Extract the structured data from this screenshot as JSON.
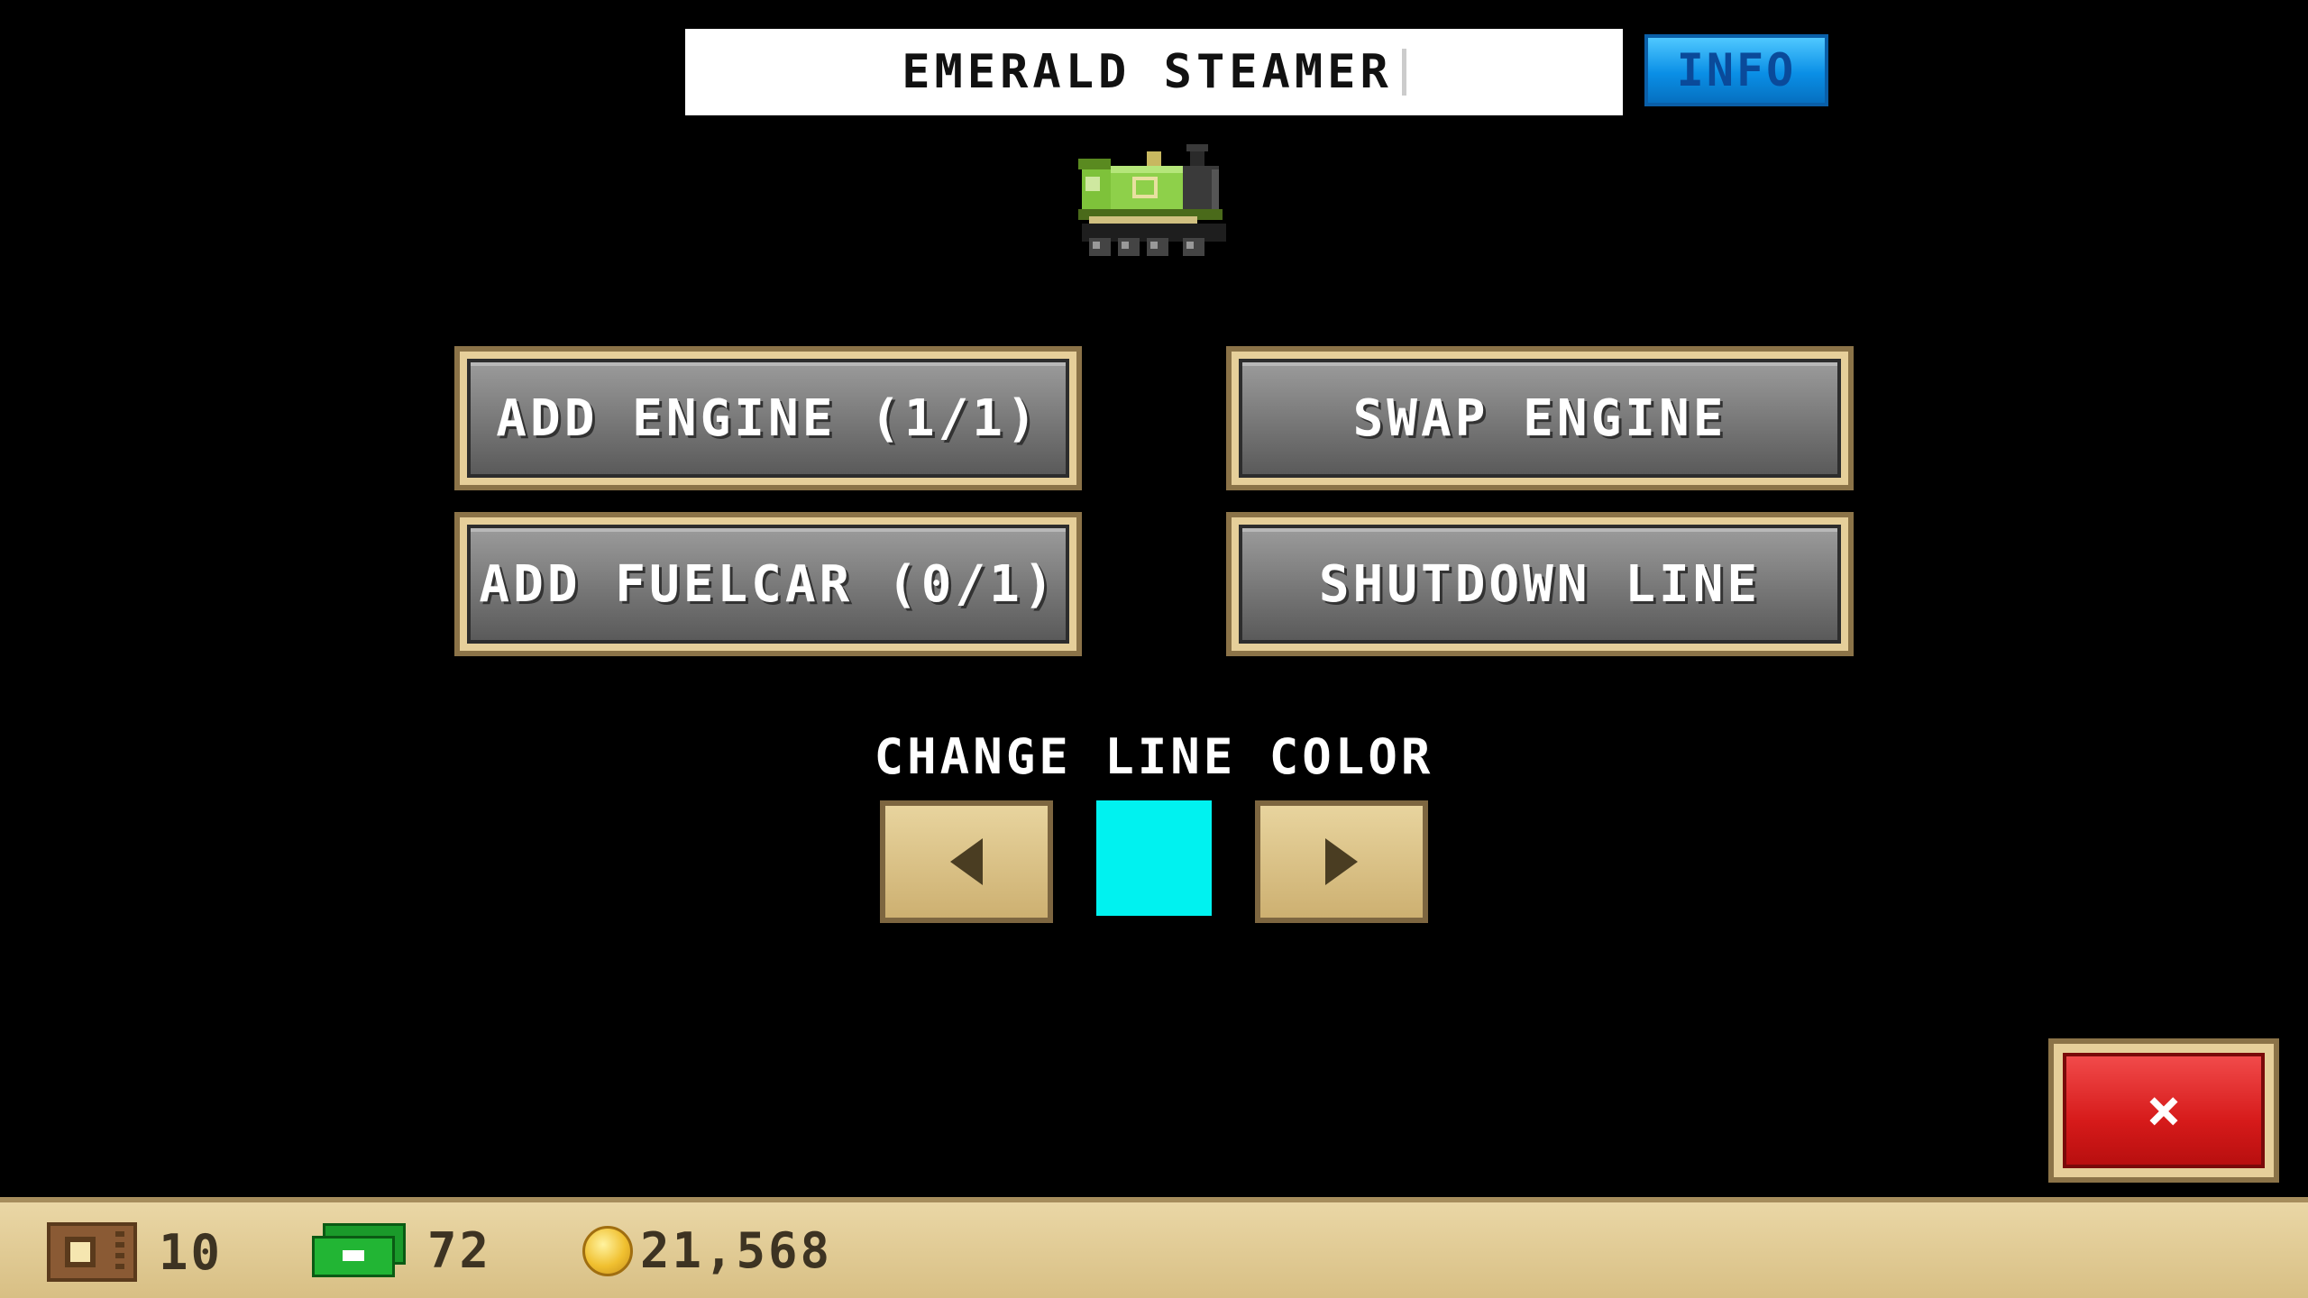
{
  "header": {
    "train_name": "EMERALD STEAMER",
    "info_label": "INFO"
  },
  "train": {
    "icon": "green-steam-locomotive-icon"
  },
  "actions": {
    "add_engine": "ADD ENGINE (1/1)",
    "swap_engine": "SWAP ENGINE",
    "add_fuelcar": "ADD FUELCAR (0/1)",
    "shutdown_line": "SHUTDOWN LINE"
  },
  "line_color": {
    "label": "CHANGE LINE COLOR",
    "current_color": "#00F2F0"
  },
  "close": {
    "label": "×"
  },
  "resources": {
    "tickets": "10",
    "cash": "72",
    "coins": "21,568"
  }
}
